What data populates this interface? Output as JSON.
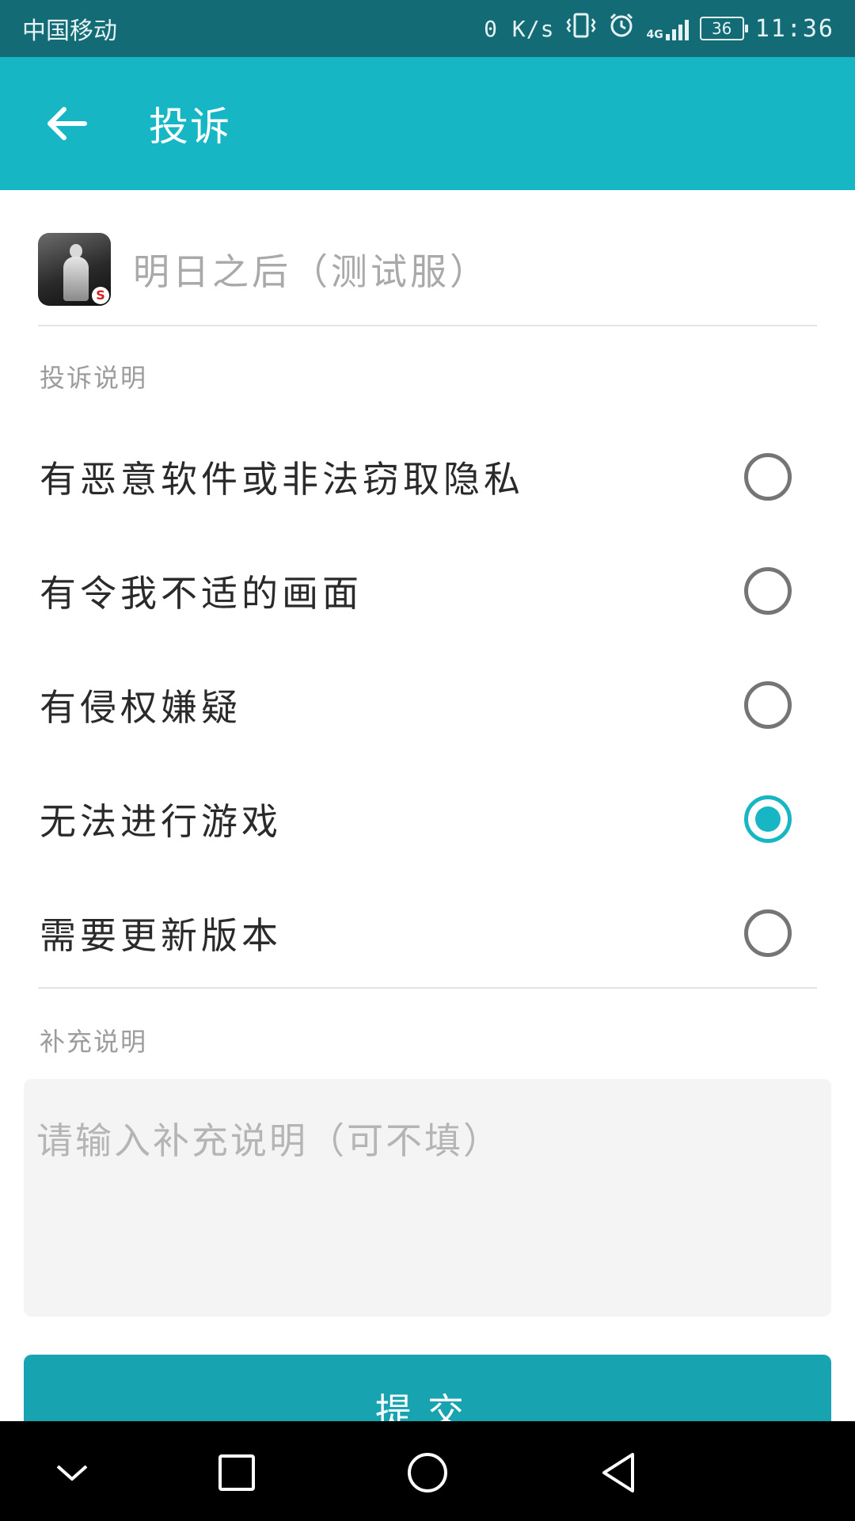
{
  "status_bar": {
    "carrier": "中国移动",
    "net_speed": "0 K/s",
    "network_type": "4G",
    "battery_level": "36",
    "time": "11:36",
    "icons": [
      "vibrate-icon",
      "alarm-icon",
      "signal-icon",
      "battery-icon"
    ]
  },
  "app_bar": {
    "title": "投诉",
    "back_icon": "arrow-left-icon",
    "background_color": "#17b6c5"
  },
  "game": {
    "name": "明日之后（测试服）",
    "icon": "game-icon",
    "badge_text": "S"
  },
  "complaint_section": {
    "label": "投诉说明",
    "options": [
      {
        "label": "有恶意软件或非法窃取隐私",
        "checked": false
      },
      {
        "label": "有令我不适的画面",
        "checked": false
      },
      {
        "label": "有侵权嫌疑",
        "checked": false
      },
      {
        "label": "无法进行游戏",
        "checked": true
      },
      {
        "label": "需要更新版本",
        "checked": false
      }
    ]
  },
  "supplement_section": {
    "label": "补充说明",
    "input_value": "",
    "input_placeholder": "请输入补充说明（可不填）"
  },
  "submit": {
    "label": "提交",
    "color": "#17a3b0"
  },
  "nav_bar": {
    "icons": [
      "collapse-chevron-icon",
      "recent-apps-icon",
      "home-icon",
      "back-triangle-icon"
    ]
  },
  "accent_color": "#17b6c5",
  "status_bar_color": "#136b75"
}
